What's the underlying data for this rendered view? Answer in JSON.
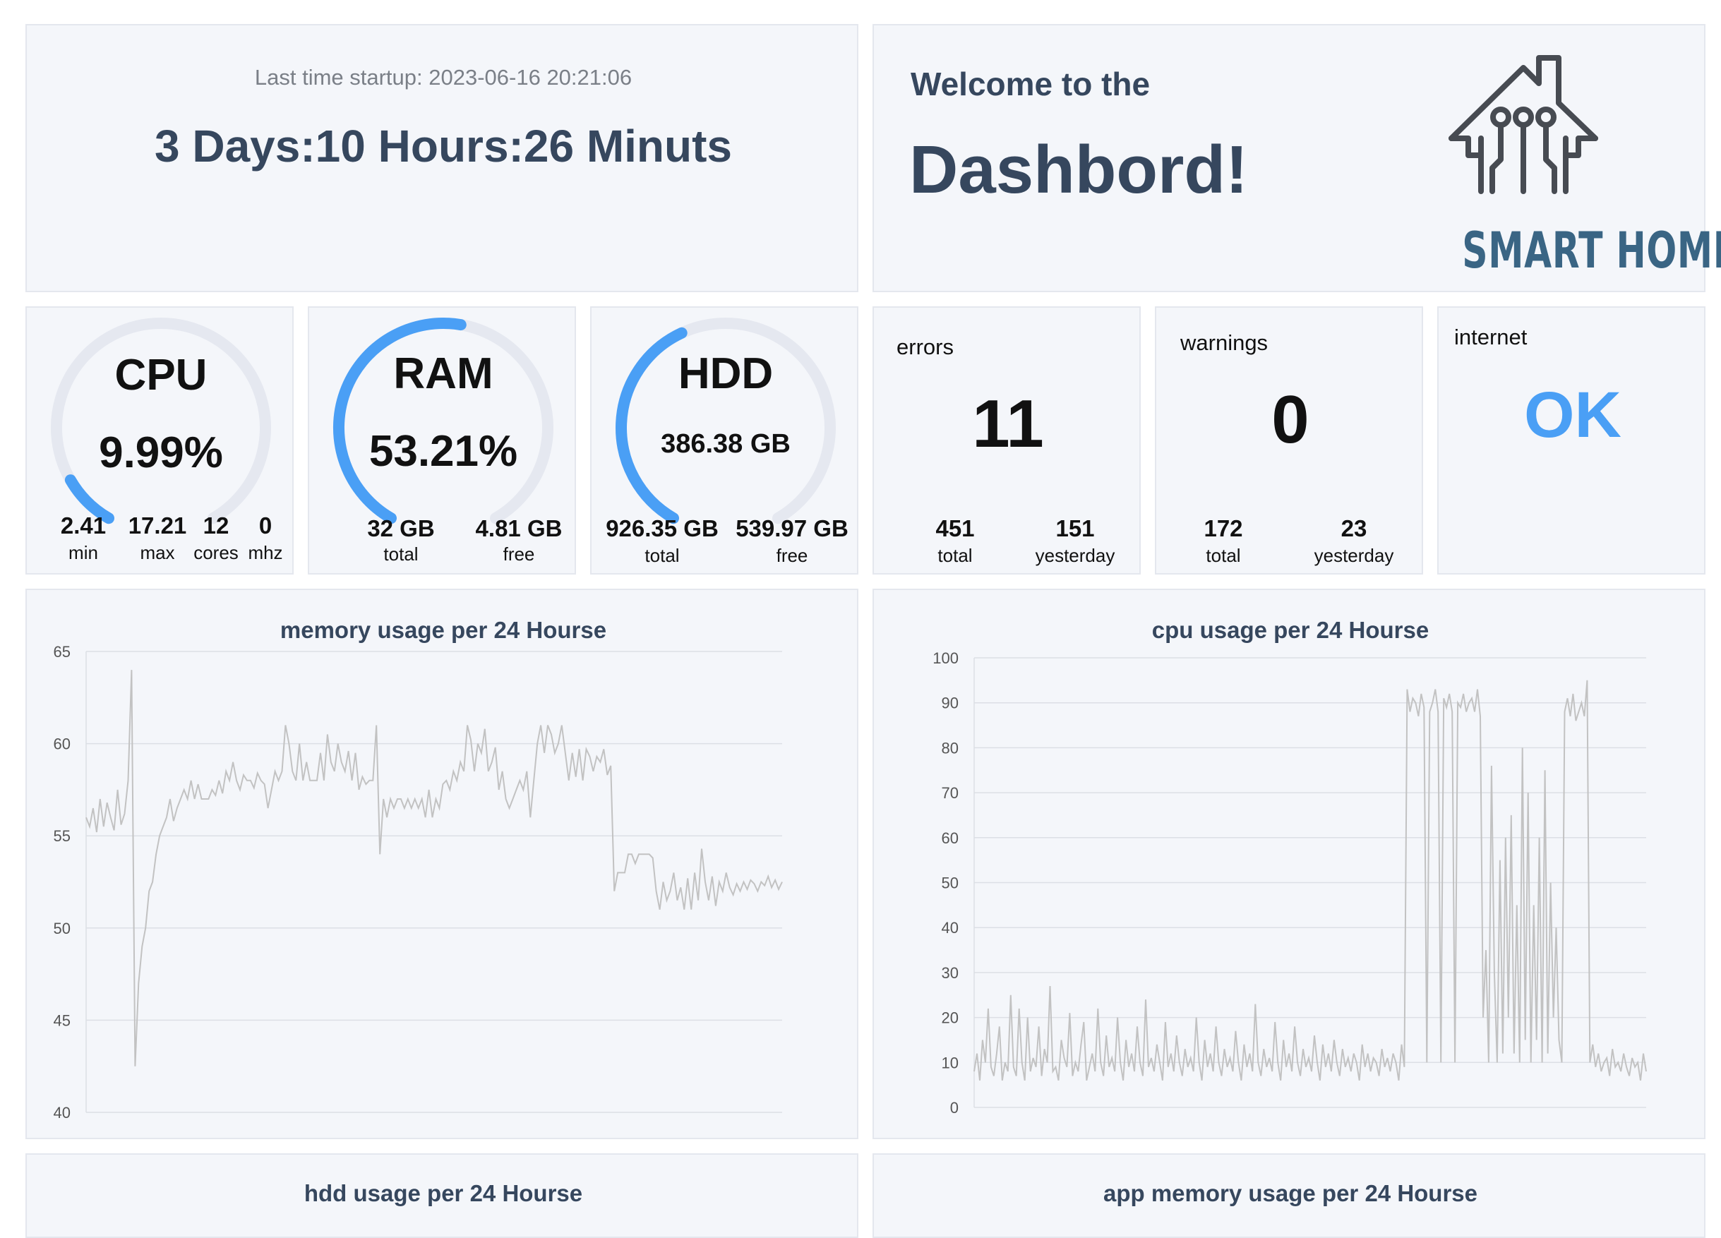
{
  "uptime": {
    "startup_label": "Last time startup: 2023-06-16 20:21:06",
    "duration": "3 Days:10 Hours:26 Minuts"
  },
  "welcome": {
    "line1": "Welcome to the",
    "line2": "Dashbord!",
    "logo_text": "SMART HOME"
  },
  "cpu": {
    "title": "CPU",
    "value": "9.99%",
    "percent": 9.99,
    "stats": [
      {
        "value": "2.41",
        "label": "min"
      },
      {
        "value": "17.21",
        "label": "max"
      },
      {
        "value": "12",
        "label": "cores"
      },
      {
        "value": "0",
        "label": "mhz"
      }
    ]
  },
  "ram": {
    "title": "RAM",
    "value": "53.21%",
    "percent": 53.21,
    "stats": [
      {
        "value": "32 GB",
        "label": "total"
      },
      {
        "value": "4.81 GB",
        "label": "free"
      }
    ]
  },
  "hdd": {
    "title": "HDD",
    "value": "386.38 GB",
    "percent": 41.7,
    "stats": [
      {
        "value": "926.35 GB",
        "label": "total"
      },
      {
        "value": "539.97 GB",
        "label": "free"
      }
    ]
  },
  "errors": {
    "label": "errors",
    "count": "11",
    "stats": [
      {
        "value": "451",
        "label": "total"
      },
      {
        "value": "151",
        "label": "yesterday"
      }
    ]
  },
  "warnings": {
    "label": "warnings",
    "count": "0",
    "stats": [
      {
        "value": "172",
        "label": "total"
      },
      {
        "value": "23",
        "label": "yesterday"
      }
    ]
  },
  "internet": {
    "label": "internet",
    "status": "OK"
  },
  "colors": {
    "accent": "#4a9ff5",
    "dark": "#36475e",
    "card": "#f4f6fa",
    "track": "#e5e8f0",
    "line": "#c2c2c2"
  },
  "chart_data": [
    {
      "type": "line",
      "title": "memory usage per 24 Hourse",
      "ylim": [
        40,
        65
      ],
      "yticks": [
        "65",
        "60",
        "55",
        "50",
        "45",
        "40"
      ],
      "x": [
        0,
        1,
        2,
        3,
        4,
        5,
        6,
        7,
        8,
        9,
        10,
        11,
        12,
        13,
        14,
        15,
        16,
        17,
        18,
        19,
        20,
        21,
        22,
        23,
        24,
        25,
        26,
        27,
        28,
        29,
        30,
        31,
        32,
        33,
        34,
        35,
        36,
        37,
        38,
        39,
        40,
        41,
        42,
        43,
        44,
        45,
        46,
        47,
        48,
        49,
        50,
        51,
        52,
        53,
        54,
        55,
        56,
        57,
        58,
        59,
        60,
        61,
        62,
        63,
        64,
        65,
        66,
        67,
        68,
        69,
        70,
        71,
        72,
        73,
        74,
        75,
        76,
        77,
        78,
        79,
        80,
        81,
        82,
        83,
        84,
        85,
        86,
        87,
        88,
        89,
        90,
        91,
        92,
        93,
        94,
        95,
        96,
        97,
        98,
        99,
        100,
        101,
        102,
        103,
        104,
        105,
        106,
        107,
        108,
        109,
        110,
        111,
        112,
        113,
        114,
        115,
        116,
        117,
        118,
        119,
        120,
        121,
        122,
        123,
        124,
        125,
        126,
        127,
        128,
        129,
        130,
        131,
        132,
        133,
        134,
        135,
        136,
        137,
        138,
        139,
        140,
        141,
        142,
        143,
        144,
        145,
        146,
        147,
        148,
        149,
        150,
        151,
        152,
        153,
        154,
        155,
        156,
        157,
        158,
        159,
        160,
        161,
        162,
        163,
        164,
        165,
        166,
        167,
        168,
        169,
        170,
        171,
        172,
        173,
        174,
        175,
        176,
        177,
        178,
        179,
        180,
        181,
        182,
        183,
        184,
        185,
        186,
        187,
        188,
        189,
        190,
        191,
        192,
        193,
        194,
        195,
        196,
        197,
        198,
        199
      ],
      "series": [
        {
          "values": [
            56,
            55.5,
            56.5,
            55.2,
            57,
            55.5,
            56.8,
            56,
            55.3,
            57.5,
            55.6,
            56.2,
            58,
            64,
            42.5,
            47,
            49,
            50,
            52,
            52.5,
            54,
            55,
            55.5,
            56,
            57,
            55.8,
            56.5,
            57,
            57.5,
            57,
            58,
            57,
            57.8,
            57,
            57,
            57,
            57.5,
            57.2,
            58,
            57.3,
            58.5,
            58,
            59,
            58,
            57.5,
            58.3,
            58,
            58,
            57.6,
            58.4,
            58,
            57.8,
            56.5,
            57.5,
            58.5,
            58,
            58.5,
            61,
            60,
            58.5,
            58,
            60,
            58,
            59,
            58,
            58,
            58,
            59.5,
            58,
            60.5,
            59,
            58.5,
            60,
            59,
            58.5,
            59.6,
            58,
            59.5,
            57.5,
            58.2,
            57.8,
            58,
            58,
            61,
            54,
            57,
            56,
            57,
            56.5,
            57,
            57,
            56.5,
            57,
            56.5,
            57,
            56.5,
            57,
            56,
            57.5,
            56,
            57,
            56.5,
            57.8,
            58,
            57.5,
            58.5,
            58,
            59,
            58.5,
            61,
            60.2,
            58.5,
            60,
            59.5,
            60.8,
            58.5,
            59,
            59.8,
            57.5,
            58.5,
            57,
            56.5,
            57,
            57.5,
            58,
            57.5,
            58.5,
            56,
            58,
            60,
            61,
            59.5,
            61,
            60.5,
            59.5,
            60,
            61,
            59.5,
            58,
            59.5,
            58.2,
            59.7,
            58,
            59.7,
            59.3,
            58.5,
            59.3,
            59,
            59.7,
            58.3,
            58.8,
            52,
            53,
            53,
            53,
            54,
            54,
            53.5,
            54,
            54,
            54,
            54,
            53.8,
            52,
            51,
            52.5,
            51.5,
            52,
            53,
            51.5,
            52.2,
            51,
            52.7,
            51,
            53,
            51.5,
            54.3,
            52.5,
            51.5,
            52.8,
            51.2,
            52.5,
            52,
            53,
            52.2,
            51.8,
            52.4,
            52,
            52.5,
            52.1,
            52.6,
            52.4,
            52,
            52.5,
            52.3,
            52.8,
            52.2,
            52.6,
            52.1,
            52.5,
            52.3,
            52.6
          ]
        }
      ]
    },
    {
      "type": "line",
      "title": "cpu usage per 24 Hourse",
      "ylim": [
        0,
        100
      ],
      "yticks": [
        "100",
        "90",
        "80",
        "70",
        "60",
        "50",
        "40",
        "30",
        "20",
        "10",
        "0"
      ],
      "x": [
        0,
        1,
        2,
        3,
        4,
        5,
        6,
        7,
        8,
        9,
        10,
        11,
        12,
        13,
        14,
        15,
        16,
        17,
        18,
        19,
        20,
        21,
        22,
        23,
        24,
        25,
        26,
        27,
        28,
        29,
        30,
        31,
        32,
        33,
        34,
        35,
        36,
        37,
        38,
        39,
        40,
        41,
        42,
        43,
        44,
        45,
        46,
        47,
        48,
        49,
        50,
        51,
        52,
        53,
        54,
        55,
        56,
        57,
        58,
        59,
        60,
        61,
        62,
        63,
        64,
        65,
        66,
        67,
        68,
        69,
        70,
        71,
        72,
        73,
        74,
        75,
        76,
        77,
        78,
        79,
        80,
        81,
        82,
        83,
        84,
        85,
        86,
        87,
        88,
        89,
        90,
        91,
        92,
        93,
        94,
        95,
        96,
        97,
        98,
        99,
        100,
        101,
        102,
        103,
        104,
        105,
        106,
        107,
        108,
        109,
        110,
        111,
        112,
        113,
        114,
        115,
        116,
        117,
        118,
        119,
        120,
        121,
        122,
        123,
        124,
        125,
        126,
        127,
        128,
        129,
        130,
        131,
        132,
        133,
        134,
        135,
        136,
        137,
        138,
        139,
        140,
        141,
        142,
        143,
        144,
        145,
        146,
        147,
        148,
        149,
        150,
        151,
        152,
        153,
        154,
        155,
        156,
        157,
        158,
        159,
        160,
        161,
        162,
        163,
        164,
        165,
        166,
        167,
        168,
        169,
        170,
        171,
        172,
        173,
        174,
        175,
        176,
        177,
        178,
        179,
        180,
        181,
        182,
        183,
        184,
        185,
        186,
        187,
        188,
        189,
        190,
        191,
        192,
        193,
        194,
        195,
        196,
        197,
        198,
        199,
        200,
        201,
        202,
        203,
        204,
        205,
        206,
        207,
        208,
        209,
        210,
        211,
        212,
        213,
        214,
        215,
        216,
        217,
        218,
        219,
        220,
        221,
        222,
        223,
        224,
        225,
        226,
        227,
        228,
        229,
        230,
        231,
        232,
        233,
        234,
        235,
        236,
        237,
        238,
        239
      ],
      "series": [
        {
          "values": [
            8,
            12,
            6,
            15,
            10,
            22,
            9,
            7,
            12,
            18,
            6,
            10,
            8,
            25,
            9,
            7,
            22,
            10,
            6,
            20,
            8,
            11,
            9,
            18,
            7,
            13,
            10,
            27,
            8,
            9,
            6,
            15,
            11,
            9,
            21,
            7,
            10,
            8,
            14,
            19,
            6,
            9,
            12,
            8,
            22,
            10,
            7,
            16,
            9,
            11,
            8,
            20,
            10,
            6,
            15,
            9,
            12,
            8,
            18,
            10,
            7,
            24,
            9,
            11,
            8,
            14,
            10,
            6,
            19,
            9,
            12,
            8,
            16,
            10,
            7,
            13,
            9,
            11,
            8,
            20,
            10,
            6,
            15,
            9,
            12,
            8,
            18,
            10,
            7,
            13,
            9,
            11,
            8,
            17,
            10,
            6,
            14,
            9,
            12,
            8,
            23,
            10,
            7,
            13,
            9,
            11,
            8,
            19,
            10,
            6,
            15,
            9,
            12,
            8,
            18,
            10,
            7,
            13,
            9,
            11,
            8,
            16,
            10,
            6,
            14,
            9,
            12,
            8,
            15,
            10,
            7,
            13,
            9,
            11,
            8,
            12,
            10,
            6,
            14,
            9,
            12,
            8,
            11,
            10,
            7,
            13,
            9,
            11,
            8,
            12,
            10,
            6,
            14,
            9,
            93,
            88,
            91,
            90,
            87,
            92,
            89,
            10,
            88,
            90,
            93,
            88,
            10,
            91,
            89,
            92,
            88,
            10,
            90,
            89,
            92,
            88,
            90,
            91,
            88,
            93,
            87,
            20,
            35,
            10,
            76,
            30,
            10,
            55,
            12,
            60,
            20,
            65,
            12,
            45,
            10,
            80,
            15,
            70,
            10,
            45,
            15,
            60,
            10,
            75,
            12,
            50,
            20,
            40,
            15,
            10,
            88,
            91,
            87,
            92,
            86,
            88,
            90,
            87,
            95,
            10,
            14,
            9,
            12,
            8,
            10,
            11,
            7,
            13,
            9,
            10,
            8,
            12,
            9,
            7,
            11,
            9,
            10,
            6,
            12,
            8,
            11,
            9,
            10,
            8,
            12,
            7
          ]
        }
      ]
    },
    {
      "type": "line",
      "title": "hdd usage per 24 Hourse"
    },
    {
      "type": "line",
      "title": "app memory usage per 24 Hourse"
    }
  ]
}
